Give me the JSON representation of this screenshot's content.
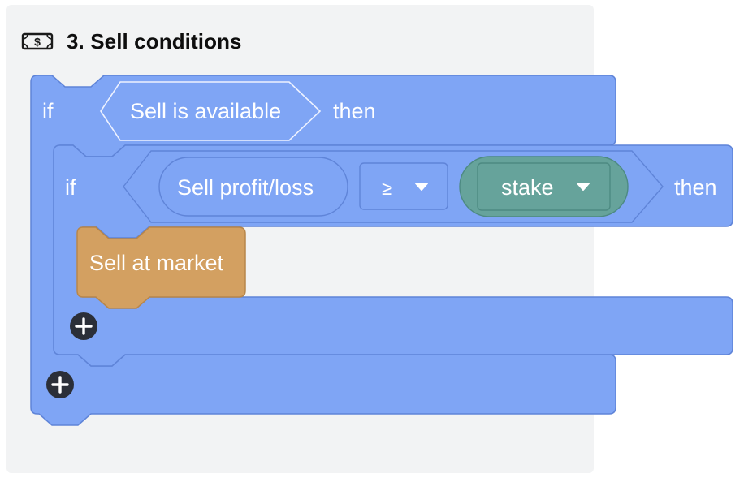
{
  "section": {
    "title": "3. Sell conditions",
    "icon": "banknote-icon"
  },
  "outer_if": {
    "if_label": "if",
    "condition": "Sell is available",
    "then_label": "then",
    "color": "#7fa5f5"
  },
  "inner_if": {
    "if_label": "if",
    "left_operand": "Sell profit/loss",
    "operator": "≥",
    "right_operand": "stake",
    "then_label": "then",
    "color": "#7fa5f5",
    "stake_color": "#66a39b"
  },
  "action": {
    "label": "Sell at market",
    "color": "#d3a061"
  },
  "add_buttons": {
    "inner_add": "+",
    "outer_add": "+"
  }
}
